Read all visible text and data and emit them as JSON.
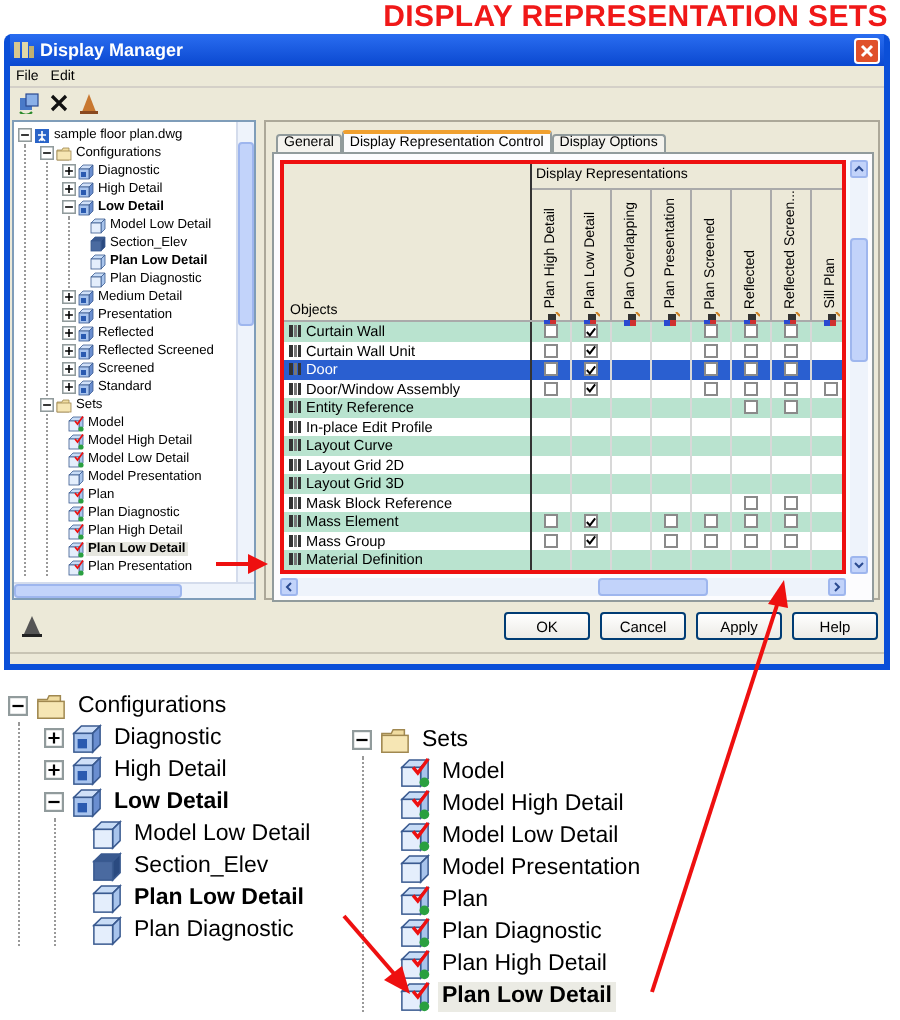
{
  "heading": "DISPLAY REPRESENTATION SETS",
  "window": {
    "title": "Display Manager"
  },
  "menu": [
    "File",
    "Edit"
  ],
  "tree": [
    {
      "label": "sample floor plan.dwg",
      "kind": "file",
      "expanded": true,
      "current": false,
      "selected": false,
      "children": [
        {
          "label": "Configurations",
          "kind": "folder",
          "expanded": true,
          "current": false,
          "selected": false,
          "children": [
            {
              "label": "Diagnostic",
              "kind": "config",
              "expanded": false,
              "current": false,
              "selected": false
            },
            {
              "label": "High Detail",
              "kind": "config",
              "expanded": false,
              "current": false,
              "selected": false
            },
            {
              "label": "Low Detail",
              "kind": "config",
              "expanded": true,
              "current": true,
              "selected": false,
              "children": [
                {
                  "label": "Model Low Detail",
                  "kind": "rep",
                  "current": false,
                  "selected": false
                },
                {
                  "label": "Section_Elev",
                  "kind": "rep-filled",
                  "current": false,
                  "selected": false
                },
                {
                  "label": "Plan Low Detail",
                  "kind": "rep",
                  "current": true,
                  "selected": false
                },
                {
                  "label": "Plan Diagnostic",
                  "kind": "rep",
                  "current": false,
                  "selected": false
                }
              ]
            },
            {
              "label": "Medium Detail",
              "kind": "config",
              "expanded": false,
              "current": false,
              "selected": false
            },
            {
              "label": "Presentation",
              "kind": "config",
              "expanded": false,
              "current": false,
              "selected": false
            },
            {
              "label": "Reflected",
              "kind": "config",
              "expanded": false,
              "current": false,
              "selected": false
            },
            {
              "label": "Reflected Screened",
              "kind": "config",
              "expanded": false,
              "current": false,
              "selected": false
            },
            {
              "label": "Screened",
              "kind": "config",
              "expanded": false,
              "current": false,
              "selected": false
            },
            {
              "label": "Standard",
              "kind": "config",
              "expanded": false,
              "current": false,
              "selected": false
            }
          ]
        },
        {
          "label": "Sets",
          "kind": "folder",
          "expanded": true,
          "current": false,
          "selected": false,
          "children": [
            {
              "label": "Model",
              "kind": "set-checked",
              "current": false,
              "selected": false
            },
            {
              "label": "Model High Detail",
              "kind": "set-checked",
              "current": false,
              "selected": false
            },
            {
              "label": "Model Low Detail",
              "kind": "set-checked",
              "current": false,
              "selected": false
            },
            {
              "label": "Model Presentation",
              "kind": "set",
              "current": false,
              "selected": false
            },
            {
              "label": "Plan",
              "kind": "set-checked",
              "current": false,
              "selected": false
            },
            {
              "label": "Plan Diagnostic",
              "kind": "set-checked",
              "current": false,
              "selected": false
            },
            {
              "label": "Plan High Detail",
              "kind": "set-checked",
              "current": false,
              "selected": false
            },
            {
              "label": "Plan Low Detail",
              "kind": "set-checked",
              "current": true,
              "selected": true
            },
            {
              "label": "Plan Presentation",
              "kind": "set-checked",
              "current": false,
              "selected": false
            }
          ]
        }
      ]
    }
  ],
  "tabs": [
    {
      "label": "General",
      "selected": false
    },
    {
      "label": "Display Representation Control",
      "selected": true
    },
    {
      "label": "Display Options",
      "selected": false
    }
  ],
  "grid": {
    "group_heading": "Display Representations",
    "objects_heading": "Objects",
    "columns": [
      "Plan High Detail",
      "Plan Low Detail",
      "Plan Overlapping",
      "Plan Presentation",
      "Plan Screened",
      "Reflected",
      "Reflected Screen...",
      "Sill Plan"
    ],
    "rows": [
      {
        "name": "Curtain Wall",
        "selected": false,
        "cells": [
          {
            "checked": false
          },
          {
            "checked": true
          },
          null,
          null,
          {
            "checked": false
          },
          {
            "checked": false
          },
          {
            "checked": false
          },
          null
        ]
      },
      {
        "name": "Curtain Wall Unit",
        "selected": false,
        "cells": [
          {
            "checked": false
          },
          {
            "checked": true
          },
          null,
          null,
          {
            "checked": false
          },
          {
            "checked": false
          },
          {
            "checked": false
          },
          null
        ]
      },
      {
        "name": "Door",
        "selected": true,
        "cells": [
          {
            "checked": false
          },
          {
            "checked": true
          },
          null,
          null,
          {
            "checked": false
          },
          {
            "checked": false
          },
          {
            "checked": false
          },
          null
        ]
      },
      {
        "name": "Door/Window Assembly",
        "selected": false,
        "cells": [
          {
            "checked": false
          },
          {
            "checked": true
          },
          null,
          null,
          {
            "checked": false
          },
          {
            "checked": false
          },
          {
            "checked": false
          },
          {
            "checked": false
          }
        ]
      },
      {
        "name": "Entity Reference",
        "selected": false,
        "cells": [
          null,
          null,
          null,
          null,
          null,
          {
            "checked": false
          },
          {
            "checked": false
          },
          null
        ]
      },
      {
        "name": "In-place Edit Profile",
        "selected": false,
        "cells": [
          null,
          null,
          null,
          null,
          null,
          null,
          null,
          null
        ]
      },
      {
        "name": "Layout Curve",
        "selected": false,
        "cells": [
          null,
          null,
          null,
          null,
          null,
          null,
          null,
          null
        ]
      },
      {
        "name": "Layout Grid 2D",
        "selected": false,
        "cells": [
          null,
          null,
          null,
          null,
          null,
          null,
          null,
          null
        ]
      },
      {
        "name": "Layout Grid 3D",
        "selected": false,
        "cells": [
          null,
          null,
          null,
          null,
          null,
          null,
          null,
          null
        ]
      },
      {
        "name": "Mask Block Reference",
        "selected": false,
        "cells": [
          null,
          null,
          null,
          null,
          null,
          {
            "checked": false
          },
          {
            "checked": false
          },
          null
        ]
      },
      {
        "name": "Mass Element",
        "selected": false,
        "cells": [
          {
            "checked": false
          },
          {
            "checked": true
          },
          null,
          {
            "checked": false
          },
          {
            "checked": false
          },
          {
            "checked": false
          },
          {
            "checked": false
          },
          null
        ]
      },
      {
        "name": "Mass Group",
        "selected": false,
        "cells": [
          {
            "checked": false
          },
          {
            "checked": true
          },
          null,
          {
            "checked": false
          },
          {
            "checked": false
          },
          {
            "checked": false
          },
          {
            "checked": false
          },
          null
        ]
      },
      {
        "name": "Material Definition",
        "selected": false,
        "cells": [
          null,
          null,
          null,
          null,
          null,
          null,
          null,
          null
        ]
      }
    ]
  },
  "buttons": [
    "OK",
    "Cancel",
    "Apply",
    "Help"
  ],
  "detail_trees": [
    {
      "label": "Configurations",
      "kind": "folder",
      "expanded": true,
      "current": false,
      "selected": false,
      "children": [
        {
          "label": "Diagnostic",
          "kind": "config",
          "expanded": false,
          "current": false,
          "selected": false
        },
        {
          "label": "High Detail",
          "kind": "config",
          "expanded": false,
          "current": false,
          "selected": false
        },
        {
          "label": "Low Detail",
          "kind": "config",
          "expanded": true,
          "current": true,
          "selected": false,
          "children": [
            {
              "label": "Model Low Detail",
              "kind": "rep",
              "current": false,
              "selected": false
            },
            {
              "label": "Section_Elev",
              "kind": "rep-filled",
              "current": false,
              "selected": false
            },
            {
              "label": "Plan Low Detail",
              "kind": "rep",
              "current": true,
              "selected": false
            },
            {
              "label": "Plan Diagnostic",
              "kind": "rep",
              "current": false,
              "selected": false
            }
          ]
        }
      ]
    },
    {
      "label": "Sets",
      "kind": "folder",
      "expanded": true,
      "current": false,
      "selected": false,
      "children": [
        {
          "label": "Model",
          "kind": "set-checked",
          "current": false,
          "selected": false
        },
        {
          "label": "Model High Detail",
          "kind": "set-checked",
          "current": false,
          "selected": false
        },
        {
          "label": "Model Low Detail",
          "kind": "set-checked",
          "current": false,
          "selected": false
        },
        {
          "label": "Model Presentation",
          "kind": "set",
          "current": false,
          "selected": false
        },
        {
          "label": "Plan",
          "kind": "set-checked",
          "current": false,
          "selected": false
        },
        {
          "label": "Plan Diagnostic",
          "kind": "set-checked",
          "current": false,
          "selected": false
        },
        {
          "label": "Plan High Detail",
          "kind": "set-checked",
          "current": false,
          "selected": false
        },
        {
          "label": "Plan Low Detail",
          "kind": "set-checked",
          "current": true,
          "selected": true
        }
      ]
    }
  ]
}
